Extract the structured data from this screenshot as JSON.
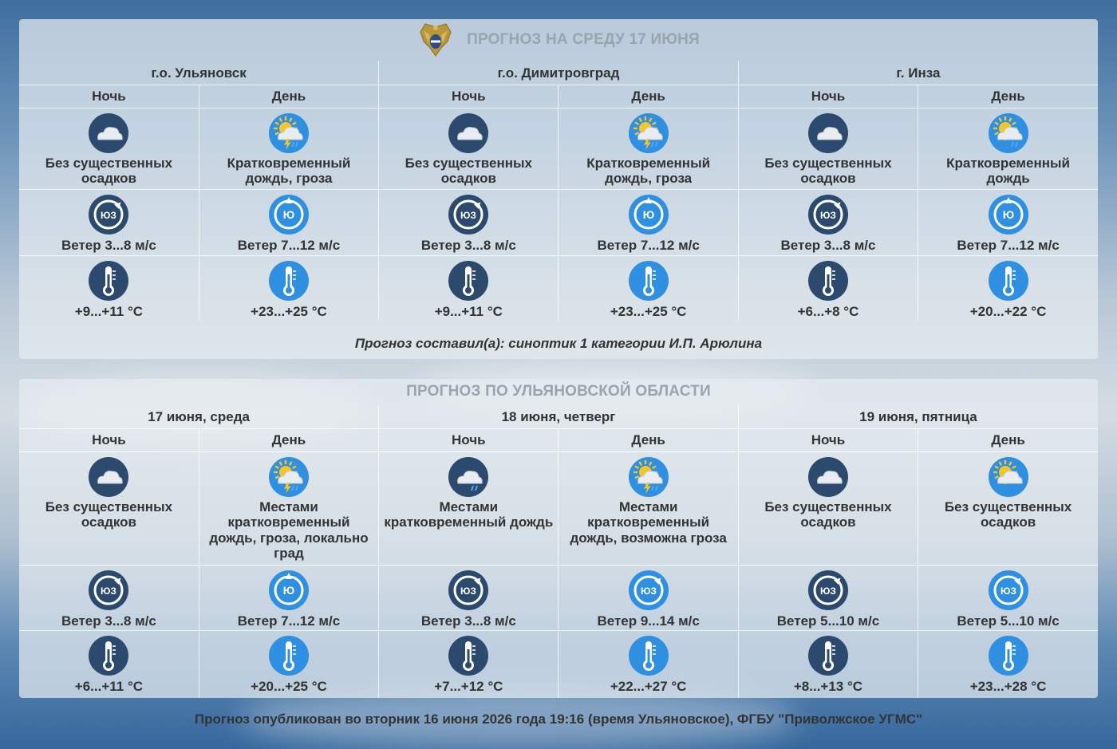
{
  "panel1": {
    "title": "ПРОГНОЗ НА СРЕДУ 17 ИЮНЯ",
    "locations": [
      "г.о. Ульяновск",
      "г.о. Димитровград",
      "г. Инза"
    ],
    "cells": [
      {
        "part": "Ночь",
        "icon": "cloud-night-icon",
        "desc": "Без существенных осадков",
        "wind_dir": "ЮЗ",
        "wind": "Ветер 3...8 м/с",
        "temp": "+9...+11 °С",
        "temp_icon": "thermometer-night-icon"
      },
      {
        "part": "День",
        "icon": "sun-cloud-thunder-rain-icon",
        "desc": "Кратковременный дождь, гроза",
        "wind_dir": "Ю",
        "wind": "Ветер 7...12 м/с",
        "temp": "+23...+25 °С",
        "temp_icon": "thermometer-day-icon"
      },
      {
        "part": "Ночь",
        "icon": "cloud-night-icon",
        "desc": "Без существенных осадков",
        "wind_dir": "ЮЗ",
        "wind": "Ветер 3...8 м/с",
        "temp": "+9...+11 °С",
        "temp_icon": "thermometer-night-icon"
      },
      {
        "part": "День",
        "icon": "sun-cloud-thunder-rain-icon",
        "desc": "Кратковременный дождь, гроза",
        "wind_dir": "Ю",
        "wind": "Ветер 7...12 м/с",
        "temp": "+23...+25 °С",
        "temp_icon": "thermometer-day-icon"
      },
      {
        "part": "Ночь",
        "icon": "cloud-night-icon",
        "desc": "Без существенных осадков",
        "wind_dir": "ЮЗ",
        "wind": "Ветер 3...8 м/с",
        "temp": "+6...+8 °С",
        "temp_icon": "thermometer-night-icon"
      },
      {
        "part": "День",
        "icon": "sun-cloud-rain-icon",
        "desc": "Кратковременный дождь",
        "wind_dir": "Ю",
        "wind": "Ветер 7...12 м/с",
        "temp": "+20...+22 °С",
        "temp_icon": "thermometer-day-icon"
      }
    ],
    "author": "Прогноз составил(а): синоптик 1 категории И.П. Арюлина"
  },
  "panel2": {
    "title": "ПРОГНОЗ ПО УЛЬЯНОВСКОЙ ОБЛАСТИ",
    "days": [
      "17 июня, среда",
      "18 июня, четверг",
      "19 июня, пятница"
    ],
    "cells": [
      {
        "part": "Ночь",
        "icon": "cloud-night-icon",
        "desc": "Без существенных осадков",
        "wind_dir": "ЮЗ",
        "wind": "Ветер 3...8 м/с",
        "temp": "+6...+11 °С",
        "temp_icon": "thermometer-night-icon"
      },
      {
        "part": "День",
        "icon": "sun-cloud-thunder-rain-icon",
        "desc": "Местами кратковременный дождь, гроза, локально град",
        "wind_dir": "Ю",
        "wind": "Ветер 7...12 м/с",
        "temp": "+20...+25 °С",
        "temp_icon": "thermometer-day-icon"
      },
      {
        "part": "Ночь",
        "icon": "cloud-rain-night-icon",
        "desc": "Местами кратковременный дождь",
        "wind_dir": "ЮЗ",
        "wind": "Ветер 3...8 м/с",
        "temp": "+7...+12 °С",
        "temp_icon": "thermometer-night-icon"
      },
      {
        "part": "День",
        "icon": "sun-cloud-thunder-rain-icon",
        "desc": "Местами кратковременный дождь, возможна гроза",
        "wind_dir": "ЮЗ",
        "wind": "Ветер 9...14 м/с",
        "temp": "+22...+27 °С",
        "temp_icon": "thermometer-day-icon"
      },
      {
        "part": "Ночь",
        "icon": "cloud-night-icon",
        "desc": "Без существенных осадков",
        "wind_dir": "ЮЗ",
        "wind": "Ветер 5...10 м/с",
        "temp": "+8...+13 °С",
        "temp_icon": "thermometer-night-icon"
      },
      {
        "part": "День",
        "icon": "sun-cloud-icon",
        "desc": "Без существенных осадков",
        "wind_dir": "ЮЗ",
        "wind": "Ветер 5...10 м/с",
        "temp": "+23...+28 °С",
        "temp_icon": "thermometer-day-icon"
      }
    ]
  },
  "footer": "Прогноз опубликован во вторник 16 июня 2026 года 19:16 (время Ульяновское), ФГБУ \"Приволжское УГМС\"",
  "colors": {
    "night": "#2b4a6e",
    "day": "#2f8fe0",
    "title": "#9aa4ae"
  }
}
